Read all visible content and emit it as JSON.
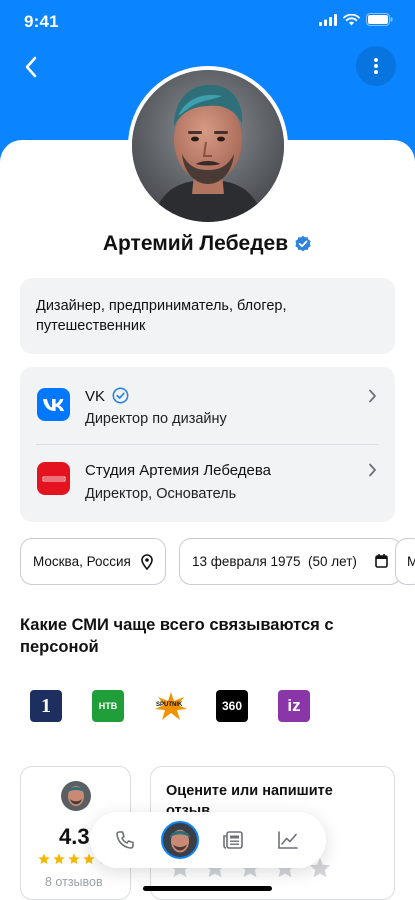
{
  "status_bar": {
    "time": "9:41"
  },
  "profile": {
    "name": "Артемий Лебедев",
    "verified": true,
    "bio": "Дизайнер, предприниматель, блогер, путешественник"
  },
  "work": [
    {
      "company": "VK",
      "role": "Директор по дизайну",
      "verified": true,
      "logo": "vk-logo"
    },
    {
      "company": "Студия Артемия Лебедева",
      "role": "Директор, Основатель",
      "logo": "studio-logo"
    }
  ],
  "chips": {
    "location": "Москва, Россия",
    "birth": "13 февраля 1975  (50 лет)",
    "extra": "М"
  },
  "media": {
    "title": "Какие СМИ чаще всего связываются с персоной",
    "outlets": [
      {
        "label": "1",
        "name": "first-channel"
      },
      {
        "label": "НТВ",
        "name": "ntv"
      },
      {
        "label": "SPUTNIK",
        "name": "sputnik"
      },
      {
        "label": "360",
        "name": "360"
      },
      {
        "label": "iz",
        "name": "izvestia"
      }
    ]
  },
  "rating": {
    "value": "4.3",
    "stars": 4,
    "reviews": "8 отзывов"
  },
  "review_prompt": {
    "title": "Оцените или напишите отзыв"
  },
  "bottom_nav": [
    "phone-icon",
    "avatar",
    "news-icon",
    "chart-icon"
  ],
  "colors": {
    "accent": "#0a84ff",
    "card": "#f2f3f5",
    "star": "#f5b800",
    "verified": "#2d81e0"
  }
}
